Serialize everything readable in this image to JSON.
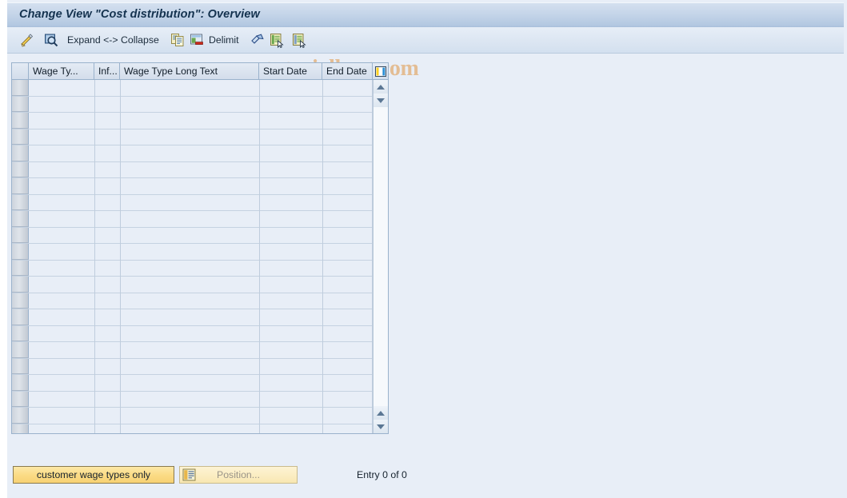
{
  "window": {
    "title": "Change View \"Cost distribution\": Overview"
  },
  "watermark": {
    "text": "www.tutorialkart.com"
  },
  "toolbar": {
    "items": [
      {
        "name": "change-entry-icon",
        "label": "",
        "icon": "pencil-magnify-icon"
      },
      {
        "name": "display-entry-icon",
        "label": "",
        "icon": "magnifier-icon"
      },
      {
        "name": "expand-collapse",
        "label": "Expand <-> Collapse",
        "icon": ""
      },
      {
        "name": "copy-as-icon",
        "label": "",
        "icon": "copy-icon"
      },
      {
        "name": "delete-icon",
        "label": "",
        "icon": "delete-row-icon"
      },
      {
        "name": "delimit-button",
        "label": "Delimit",
        "icon": ""
      },
      {
        "name": "undo-icon",
        "label": "",
        "icon": "undo-arrow-icon"
      },
      {
        "name": "select-all-icon",
        "label": "",
        "icon": "select-block-icon"
      },
      {
        "name": "deselect-all-icon",
        "label": "",
        "icon": "deselect-block-icon"
      }
    ]
  },
  "table": {
    "columns": [
      {
        "key": "wage_type",
        "label": "Wage Ty..."
      },
      {
        "key": "infotype",
        "label": "Inf..."
      },
      {
        "key": "long_text",
        "label": "Wage Type Long Text"
      },
      {
        "key": "start_date",
        "label": "Start Date"
      },
      {
        "key": "end_date",
        "label": "End Date"
      }
    ],
    "rows": [],
    "row_count": 22,
    "config_icon": "table-settings-icon"
  },
  "footer": {
    "customer_wage_types_label": "customer wage types only",
    "position_label": "Position...",
    "entry_status": "Entry 0 of 0"
  },
  "colors": {
    "page_background": "#e8eef7",
    "title_bar": "#c5d5e9",
    "accent_yellow": "#fbdc86",
    "grid_line": "#c5d2e1",
    "border": "#9ab2cc",
    "watermark": "#e2b078"
  }
}
